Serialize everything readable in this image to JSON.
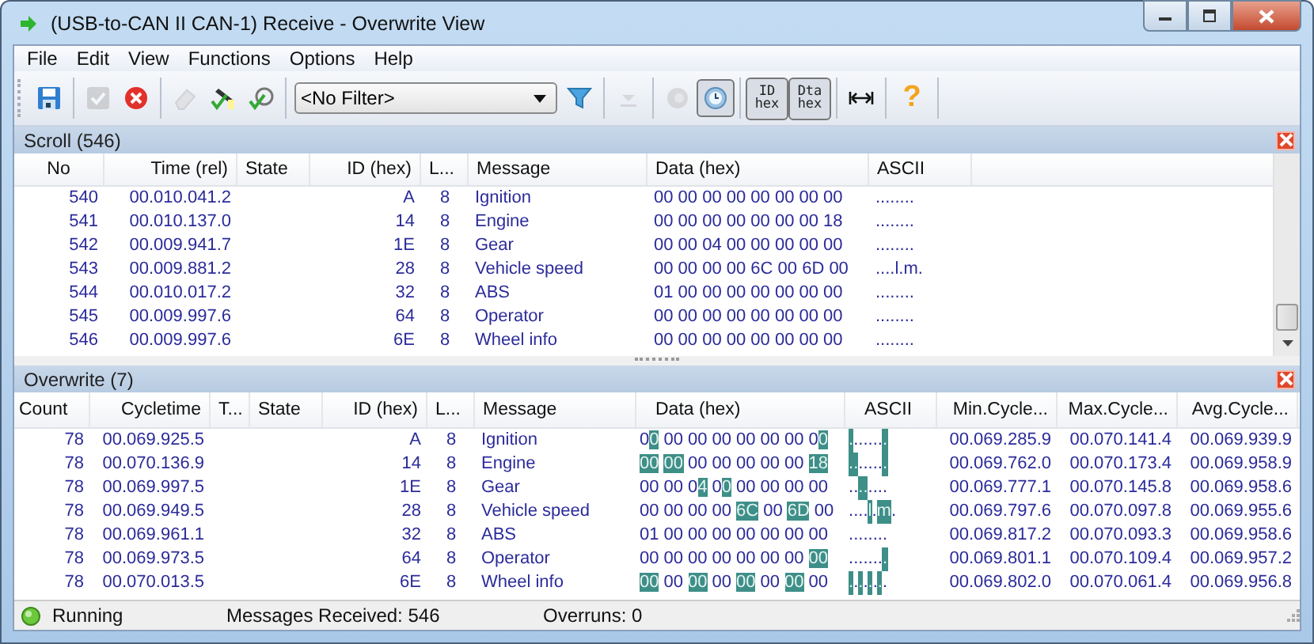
{
  "window": {
    "title": "(USB-to-CAN II  CAN-1) Receive - Overwrite View"
  },
  "menu": [
    "File",
    "Edit",
    "View",
    "Functions",
    "Options",
    "Help"
  ],
  "toolbar": [
    {
      "kind": "button",
      "disabled": false,
      "pressed": false
    },
    {
      "kind": "separator"
    },
    {
      "kind": "button",
      "disabled": true,
      "pressed": false
    },
    {
      "kind": "button",
      "disabled": false,
      "pressed": false
    },
    {
      "kind": "separator"
    },
    {
      "kind": "button",
      "disabled": true,
      "pressed": false
    },
    {
      "kind": "button",
      "disabled": false,
      "pressed": false
    },
    {
      "kind": "button",
      "disabled": false,
      "pressed": false
    },
    {
      "kind": "separator"
    },
    {
      "kind": "combo",
      "value": "<No Filter>"
    },
    {
      "kind": "button",
      "disabled": false,
      "pressed": false
    },
    {
      "kind": "separator"
    },
    {
      "kind": "button",
      "disabled": true,
      "pressed": false
    },
    {
      "kind": "separator"
    },
    {
      "kind": "button",
      "disabled": true,
      "pressed": false
    },
    {
      "kind": "button",
      "disabled": false,
      "pressed": true
    },
    {
      "kind": "separator"
    },
    {
      "kind": "text",
      "label": "ID hex",
      "pressed": true
    },
    {
      "kind": "text",
      "label": "Dta hex",
      "pressed": true
    },
    {
      "kind": "separator"
    },
    {
      "kind": "button",
      "disabled": false,
      "pressed": false
    },
    {
      "kind": "separator"
    },
    {
      "kind": "text",
      "label": "?",
      "pressed": false
    },
    {
      "kind": "separator"
    }
  ],
  "scroll": {
    "title": "Scroll (546)",
    "columns": [
      "No",
      "Time (rel)",
      "State",
      "ID (hex)",
      "L...",
      "Message",
      "Data (hex)",
      "ASCII"
    ],
    "rows": [
      [
        "540",
        "00.010.041.2",
        "",
        "A",
        "8",
        "Ignition",
        "00 00 00 00 00 00 00 00",
        "........"
      ],
      [
        "541",
        "00.010.137.0",
        "",
        "14",
        "8",
        "Engine",
        "00 00 00 00 00 00 00 18",
        "........"
      ],
      [
        "542",
        "00.009.941.7",
        "",
        "1E",
        "8",
        "Gear",
        "00 00 04 00 00 00 00 00",
        "........"
      ],
      [
        "543",
        "00.009.881.2",
        "",
        "28",
        "8",
        "Vehicle speed",
        "00 00 00 00 6C 00 6D 00",
        "....l.m."
      ],
      [
        "544",
        "00.010.017.2",
        "",
        "32",
        "8",
        "ABS",
        "01 00 00 00 00 00 00 00",
        "........"
      ],
      [
        "545",
        "00.009.997.6",
        "",
        "64",
        "8",
        "Operator",
        "00 00 00 00 00 00 00 00",
        "........"
      ],
      [
        "546",
        "00.009.997.6",
        "",
        "6E",
        "8",
        "Wheel info",
        "00 00 00 00 00 00 00 00",
        "........"
      ]
    ]
  },
  "overwrite": {
    "title": "Overwrite (7)",
    "columns": [
      "Count",
      "Cycletime",
      "T...",
      "State",
      "ID (hex)",
      "L...",
      "Message",
      "Data (hex)",
      "ASCII",
      "Min.Cycle...",
      "Max.Cycle...",
      "Avg.Cycle..."
    ],
    "rows": [
      {
        "count": "78",
        "cycletime": "00.069.925.5",
        "id": "A",
        "len": "8",
        "message": "Ignition",
        "data": [
          {
            "hex": "00",
            "high_changed": false,
            "low_changed": true
          },
          {
            "hex": "00",
            "high_changed": false,
            "low_changed": false
          },
          {
            "hex": "00",
            "high_changed": false,
            "low_changed": false
          },
          {
            "hex": "00",
            "high_changed": false,
            "low_changed": false
          },
          {
            "hex": "00",
            "high_changed": false,
            "low_changed": false
          },
          {
            "hex": "00",
            "high_changed": false,
            "low_changed": false
          },
          {
            "hex": "00",
            "high_changed": false,
            "low_changed": false
          },
          {
            "hex": "00",
            "high_changed": false,
            "low_changed": true
          }
        ],
        "ascii": [
          {
            "char": ".",
            "changed": true
          },
          {
            "char": ".",
            "changed": false
          },
          {
            "char": ".",
            "changed": false
          },
          {
            "char": ".",
            "changed": false
          },
          {
            "char": ".",
            "changed": false
          },
          {
            "char": ".",
            "changed": false
          },
          {
            "char": ".",
            "changed": false
          },
          {
            "char": ".",
            "changed": true
          }
        ],
        "min": "00.069.285.9",
        "max": "00.070.141.4",
        "avg": "00.069.939.9"
      },
      {
        "count": "78",
        "cycletime": "00.070.136.9",
        "id": "14",
        "len": "8",
        "message": "Engine",
        "data": [
          {
            "hex": "00",
            "high_changed": true,
            "low_changed": true
          },
          {
            "hex": "00",
            "high_changed": true,
            "low_changed": true
          },
          {
            "hex": "00",
            "high_changed": false,
            "low_changed": false
          },
          {
            "hex": "00",
            "high_changed": false,
            "low_changed": false
          },
          {
            "hex": "00",
            "high_changed": false,
            "low_changed": false
          },
          {
            "hex": "00",
            "high_changed": false,
            "low_changed": false
          },
          {
            "hex": "00",
            "high_changed": false,
            "low_changed": false
          },
          {
            "hex": "18",
            "high_changed": true,
            "low_changed": true
          }
        ],
        "ascii": [
          {
            "char": ".",
            "changed": true
          },
          {
            "char": ".",
            "changed": true
          },
          {
            "char": ".",
            "changed": false
          },
          {
            "char": ".",
            "changed": false
          },
          {
            "char": ".",
            "changed": false
          },
          {
            "char": ".",
            "changed": false
          },
          {
            "char": ".",
            "changed": false
          },
          {
            "char": ".",
            "changed": true
          }
        ],
        "min": "00.069.762.0",
        "max": "00.070.173.4",
        "avg": "00.069.958.9"
      },
      {
        "count": "78",
        "cycletime": "00.069.997.5",
        "id": "1E",
        "len": "8",
        "message": "Gear",
        "data": [
          {
            "hex": "00",
            "high_changed": false,
            "low_changed": false
          },
          {
            "hex": "00",
            "high_changed": false,
            "low_changed": false
          },
          {
            "hex": "04",
            "high_changed": false,
            "low_changed": true
          },
          {
            "hex": "00",
            "high_changed": false,
            "low_changed": true
          },
          {
            "hex": "00",
            "high_changed": false,
            "low_changed": false
          },
          {
            "hex": "00",
            "high_changed": false,
            "low_changed": false
          },
          {
            "hex": "00",
            "high_changed": false,
            "low_changed": false
          },
          {
            "hex": "00",
            "high_changed": false,
            "low_changed": false
          }
        ],
        "ascii": [
          {
            "char": ".",
            "changed": false
          },
          {
            "char": ".",
            "changed": false
          },
          {
            "char": ".",
            "changed": true
          },
          {
            "char": ".",
            "changed": true
          },
          {
            "char": ".",
            "changed": false
          },
          {
            "char": ".",
            "changed": false
          },
          {
            "char": ".",
            "changed": false
          },
          {
            "char": ".",
            "changed": false
          }
        ],
        "min": "00.069.777.1",
        "max": "00.070.145.8",
        "avg": "00.069.958.6"
      },
      {
        "count": "78",
        "cycletime": "00.069.949.5",
        "id": "28",
        "len": "8",
        "message": "Vehicle speed",
        "data": [
          {
            "hex": "00",
            "high_changed": false,
            "low_changed": false
          },
          {
            "hex": "00",
            "high_changed": false,
            "low_changed": false
          },
          {
            "hex": "00",
            "high_changed": false,
            "low_changed": false
          },
          {
            "hex": "00",
            "high_changed": false,
            "low_changed": false
          },
          {
            "hex": "6C",
            "high_changed": true,
            "low_changed": true
          },
          {
            "hex": "00",
            "high_changed": false,
            "low_changed": false
          },
          {
            "hex": "6D",
            "high_changed": true,
            "low_changed": true
          },
          {
            "hex": "00",
            "high_changed": false,
            "low_changed": false
          }
        ],
        "ascii": [
          {
            "char": ".",
            "changed": false
          },
          {
            "char": ".",
            "changed": false
          },
          {
            "char": ".",
            "changed": false
          },
          {
            "char": ".",
            "changed": false
          },
          {
            "char": "l",
            "changed": true
          },
          {
            "char": ".",
            "changed": false
          },
          {
            "char": "m",
            "changed": true
          },
          {
            "char": ".",
            "changed": false
          }
        ],
        "min": "00.069.797.6",
        "max": "00.070.097.8",
        "avg": "00.069.955.6"
      },
      {
        "count": "78",
        "cycletime": "00.069.961.1",
        "id": "32",
        "len": "8",
        "message": "ABS",
        "data": [
          {
            "hex": "01",
            "high_changed": false,
            "low_changed": false
          },
          {
            "hex": "00",
            "high_changed": false,
            "low_changed": false
          },
          {
            "hex": "00",
            "high_changed": false,
            "low_changed": false
          },
          {
            "hex": "00",
            "high_changed": false,
            "low_changed": false
          },
          {
            "hex": "00",
            "high_changed": false,
            "low_changed": false
          },
          {
            "hex": "00",
            "high_changed": false,
            "low_changed": false
          },
          {
            "hex": "00",
            "high_changed": false,
            "low_changed": false
          },
          {
            "hex": "00",
            "high_changed": false,
            "low_changed": false
          }
        ],
        "ascii": [
          {
            "char": ".",
            "changed": false
          },
          {
            "char": ".",
            "changed": false
          },
          {
            "char": ".",
            "changed": false
          },
          {
            "char": ".",
            "changed": false
          },
          {
            "char": ".",
            "changed": false
          },
          {
            "char": ".",
            "changed": false
          },
          {
            "char": ".",
            "changed": false
          },
          {
            "char": ".",
            "changed": false
          }
        ],
        "min": "00.069.817.2",
        "max": "00.070.093.3",
        "avg": "00.069.958.6"
      },
      {
        "count": "78",
        "cycletime": "00.069.973.5",
        "id": "64",
        "len": "8",
        "message": "Operator",
        "data": [
          {
            "hex": "00",
            "high_changed": false,
            "low_changed": false
          },
          {
            "hex": "00",
            "high_changed": false,
            "low_changed": false
          },
          {
            "hex": "00",
            "high_changed": false,
            "low_changed": false
          },
          {
            "hex": "00",
            "high_changed": false,
            "low_changed": false
          },
          {
            "hex": "00",
            "high_changed": false,
            "low_changed": false
          },
          {
            "hex": "00",
            "high_changed": false,
            "low_changed": false
          },
          {
            "hex": "00",
            "high_changed": false,
            "low_changed": false
          },
          {
            "hex": "00",
            "high_changed": true,
            "low_changed": true
          }
        ],
        "ascii": [
          {
            "char": ".",
            "changed": false
          },
          {
            "char": ".",
            "changed": false
          },
          {
            "char": ".",
            "changed": false
          },
          {
            "char": ".",
            "changed": false
          },
          {
            "char": ".",
            "changed": false
          },
          {
            "char": ".",
            "changed": false
          },
          {
            "char": ".",
            "changed": false
          },
          {
            "char": ".",
            "changed": true
          }
        ],
        "min": "00.069.801.1",
        "max": "00.070.109.4",
        "avg": "00.069.957.2"
      },
      {
        "count": "78",
        "cycletime": "00.070.013.5",
        "id": "6E",
        "len": "8",
        "message": "Wheel info",
        "data": [
          {
            "hex": "00",
            "high_changed": true,
            "low_changed": true
          },
          {
            "hex": "00",
            "high_changed": false,
            "low_changed": false
          },
          {
            "hex": "00",
            "high_changed": true,
            "low_changed": true
          },
          {
            "hex": "00",
            "high_changed": false,
            "low_changed": false
          },
          {
            "hex": "00",
            "high_changed": true,
            "low_changed": true
          },
          {
            "hex": "00",
            "high_changed": false,
            "low_changed": false
          },
          {
            "hex": "00",
            "high_changed": true,
            "low_changed": true
          },
          {
            "hex": "00",
            "high_changed": false,
            "low_changed": false
          }
        ],
        "ascii": [
          {
            "char": ".",
            "changed": true
          },
          {
            "char": ".",
            "changed": false
          },
          {
            "char": ".",
            "changed": true
          },
          {
            "char": ".",
            "changed": false
          },
          {
            "char": ".",
            "changed": true
          },
          {
            "char": ".",
            "changed": false
          },
          {
            "char": ".",
            "changed": true
          },
          {
            "char": ".",
            "changed": false
          }
        ],
        "min": "00.069.802.0",
        "max": "00.070.061.4",
        "avg": "00.069.956.8"
      }
    ]
  },
  "status_bar": {
    "state": "Running",
    "running": true,
    "received": "Messages Received: 546",
    "overruns": "Overruns: 0"
  }
}
